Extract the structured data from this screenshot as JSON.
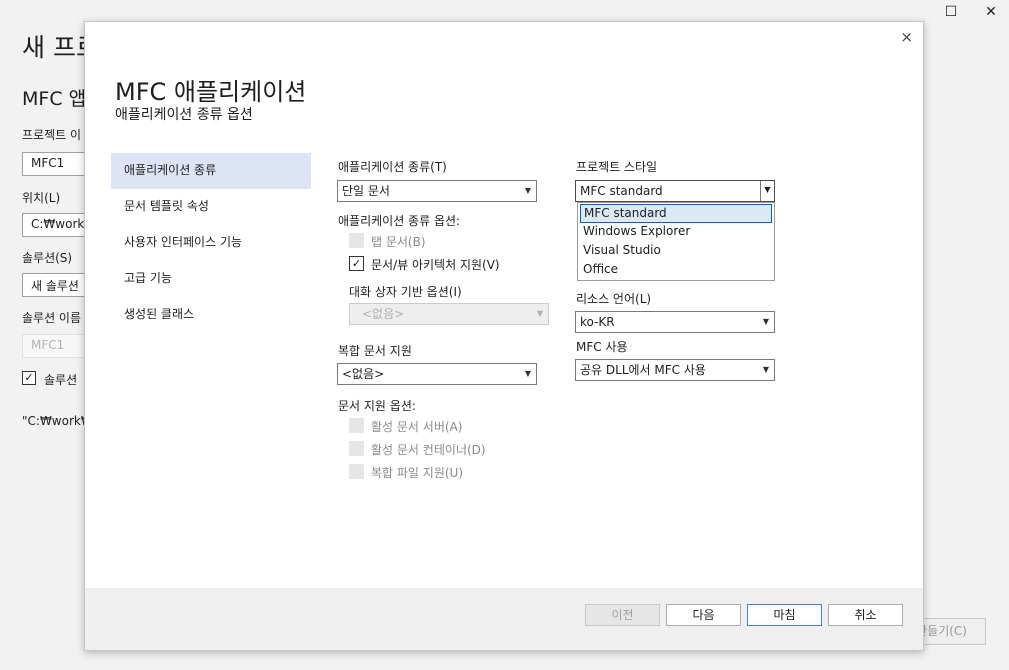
{
  "background_window": {
    "title": "새 프로",
    "subtitle": "MFC 앱",
    "project_name_label": "프로젝트 이",
    "project_name_value": "MFC1",
    "location_label": "위치(L)",
    "location_value": "C:₩work",
    "solution_label": "솔루션(S)",
    "solution_value": "새 솔루션",
    "solution_name_label": "솔루션 이름",
    "solution_name_value": "MFC1",
    "place_checkbox_label": "솔루션",
    "path_text": "\"C:₩work₩",
    "create_button": "만들기(C)"
  },
  "dialog": {
    "title": "MFC 애플리케이션",
    "subtitle": "애플리케이션 종류 옵션",
    "close_glyph": "×",
    "nav": [
      {
        "label": "애플리케이션 종류"
      },
      {
        "label": "문서 템플릿 속성"
      },
      {
        "label": "사용자 인터페이스 기능"
      },
      {
        "label": "고급 기능"
      },
      {
        "label": "생성된 클래스"
      }
    ],
    "app_type": {
      "label": "애플리케이션 종류(T)",
      "value": "단일 문서"
    },
    "app_type_options": {
      "label": "애플리케이션 종류 옵션:",
      "tabbed_docs": {
        "label": "탭 문서(B)",
        "checked": false,
        "enabled": false
      },
      "doc_view": {
        "label": "문서/뷰 아키텍처 지원(V)",
        "checked": true,
        "enabled": true
      },
      "dialog_options_label": "대화 상자 기반 옵션(I)",
      "dialog_options_value": "<없음>"
    },
    "compound_doc": {
      "label": "복합 문서 지원",
      "value": "<없음>"
    },
    "doc_support_options": {
      "label": "문서 지원 옵션:",
      "active_server": "활성 문서 서버(A)",
      "active_container": "활성 문서 컨테이너(D)",
      "compound_file": "복합 파일 지원(U)"
    },
    "project_style": {
      "label": "프로젝트 스타일",
      "value": "MFC standard",
      "options": [
        "MFC standard",
        "Windows Explorer",
        "Visual Studio",
        "Office"
      ]
    },
    "resource_language": {
      "label": "리소스 언어(L)",
      "value": "ko-KR"
    },
    "mfc_use": {
      "label": "MFC 사용",
      "value": "공유 DLL에서 MFC 사용"
    },
    "buttons": {
      "prev": "이전",
      "next": "다음",
      "finish": "마침",
      "cancel": "취소"
    }
  },
  "icons": {
    "check": "✓",
    "dropdown_arrow": "▼",
    "maximize": "☐",
    "close": "✕"
  }
}
